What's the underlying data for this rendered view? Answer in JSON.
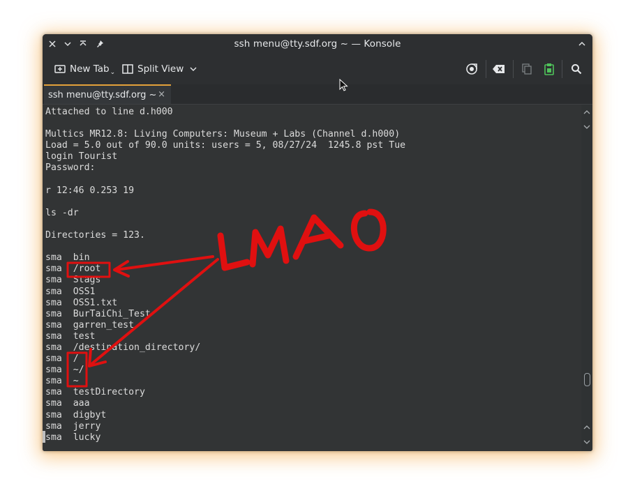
{
  "window": {
    "title": "ssh menu@tty.sdf.org ~ — Konsole"
  },
  "titlebar_icons": {
    "close": "close-icon",
    "minimize": "chevron-down-icon",
    "keep_above": "keep-above-icon",
    "pin": "pin-icon",
    "maximize": "chevron-up-icon"
  },
  "toolbar": {
    "new_tab_label": "New Tab",
    "split_view_label": "Split View"
  },
  "tab": {
    "label": "ssh menu@tty.sdf.org ~",
    "close_glyph": "×"
  },
  "terminal": {
    "lines": [
      "Attached to line d.h000",
      "",
      "Multics MR12.8: Living Computers: Museum + Labs (Channel d.h000)",
      "Load = 5.0 out of 90.0 units: users = 5, 08/27/24  1245.8 pst Tue",
      "login Tourist",
      "Password:",
      "",
      "r 12:46 0.253 19",
      "",
      "ls -dr",
      "",
      "Directories = 123.",
      "",
      "sma  bin",
      "sma  /root",
      "sma  Stags",
      "sma  OSS1",
      "sma  OSS1.txt",
      "sma  BurTaiChi_Test",
      "sma  garren_test",
      "sma  test",
      "sma  /destination_directory/",
      "sma  /",
      "sma  ~/",
      "sma  ~",
      "sma  testDirectory",
      "sma  aaa",
      "sma  digbyt",
      "sma  jerry",
      "sma  lucky"
    ]
  },
  "annotation": {
    "text": "LMAO",
    "color": "#e01010"
  },
  "colors": {
    "accent": "#e3a13a",
    "terminal_bg": "#323435",
    "terminal_fg": "#dcdcdc",
    "annotation_red": "#e01010",
    "paste_icon_green": "#4fc35a"
  }
}
